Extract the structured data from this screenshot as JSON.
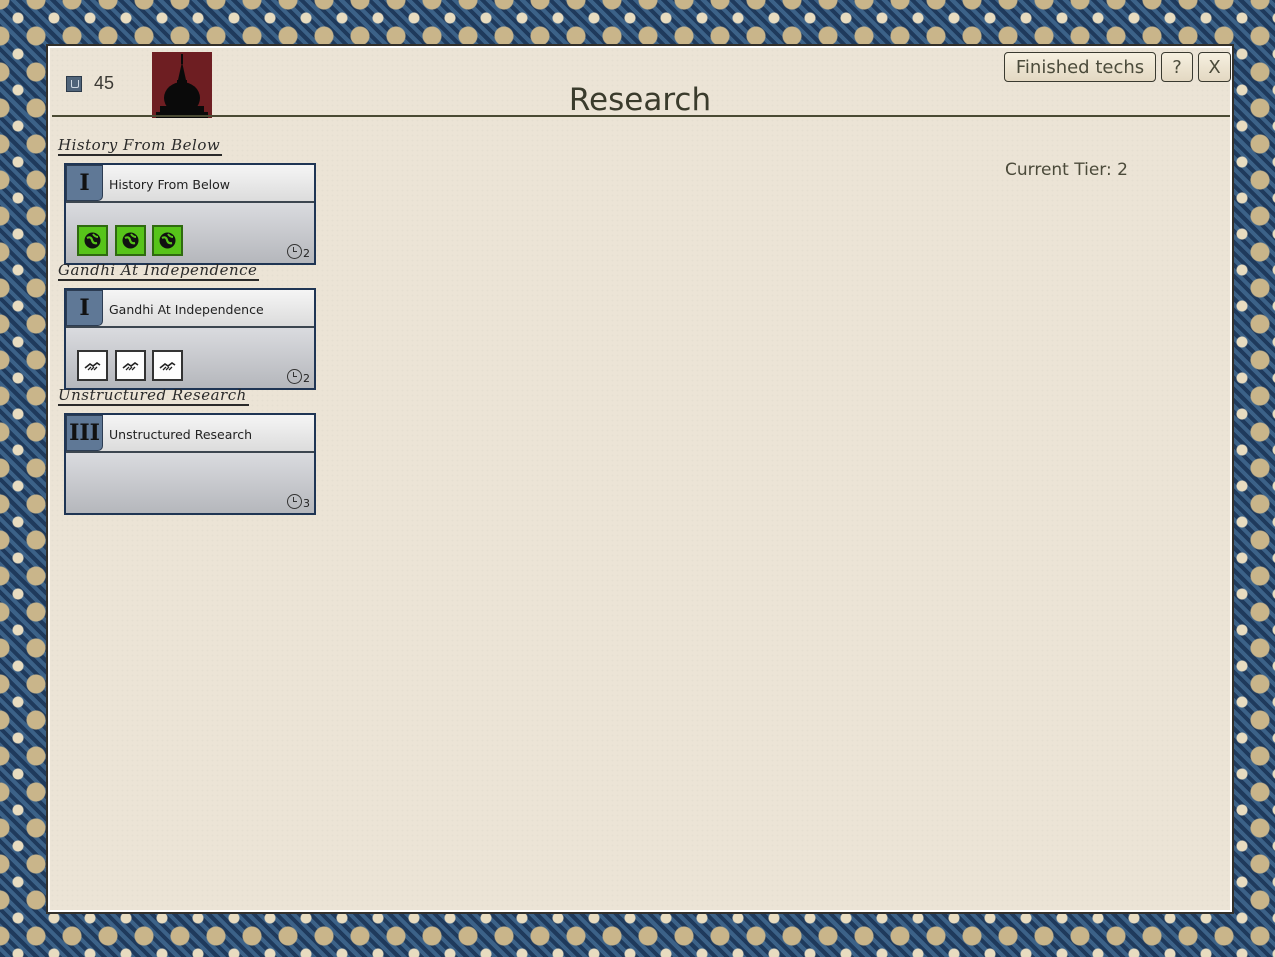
{
  "header": {
    "science_icon": "flask-icon",
    "science_value": "45",
    "portrait_icon": "stupa-icon",
    "title": "Research",
    "finished_techs_label": "Finished techs",
    "help_label": "?",
    "close_label": "X",
    "current_tier": "Current Tier: 2"
  },
  "techs": [
    {
      "category": "History From Below",
      "tier": "I",
      "name": "History From Below",
      "turns": "2",
      "unlock_style": "green",
      "unlock_icon": "globe-icon",
      "unlock_count": 3
    },
    {
      "category": "Gandhi At Independence",
      "tier": "I",
      "name": "Gandhi At Independence",
      "turns": "2",
      "unlock_style": "white",
      "unlock_icon": "handshake-icon",
      "unlock_count": 3
    },
    {
      "category": "Unstructured Research",
      "tier": "III",
      "name": "Unstructured Research",
      "turns": "3",
      "unlock_style": "none",
      "unlock_icon": "",
      "unlock_count": 0
    }
  ],
  "colors": {
    "panel_bg": "#ece4d6",
    "badge_blue": "#5f7896",
    "unlock_green": "#57c41a",
    "portrait_red": "#6e1e22"
  }
}
